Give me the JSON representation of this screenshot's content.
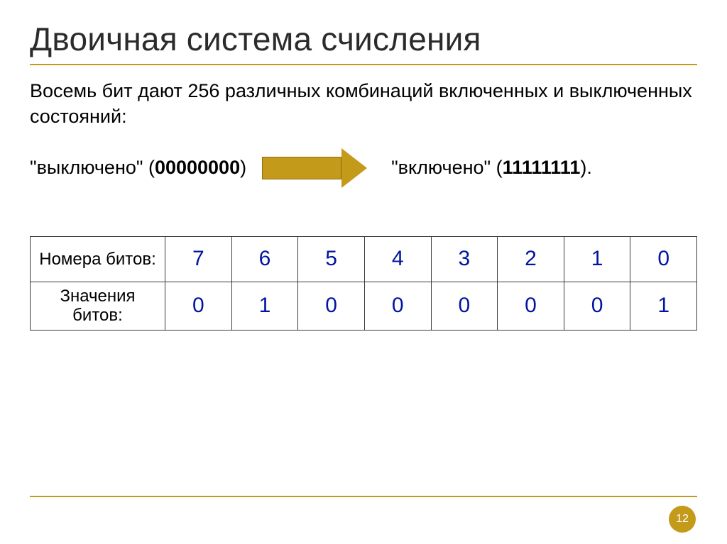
{
  "title": "Двоичная система счисления",
  "paragraph": "Восемь бит дают 256 различных комбинаций включенных и выключенных состояний:",
  "off_state": {
    "label": "\"выключено\" (",
    "code": "00000000",
    "close": ")"
  },
  "on_state": {
    "label": "\"включено\" (",
    "code": "11111111",
    "close": ")."
  },
  "table": {
    "row1_label": "Номера битов:",
    "row2_label": "Значения битов:",
    "bit_numbers": [
      "7",
      "6",
      "5",
      "4",
      "3",
      "2",
      "1",
      "0"
    ],
    "bit_values": [
      "0",
      "1",
      "0",
      "0",
      "0",
      "0",
      "0",
      "1"
    ]
  },
  "page_number": "12"
}
